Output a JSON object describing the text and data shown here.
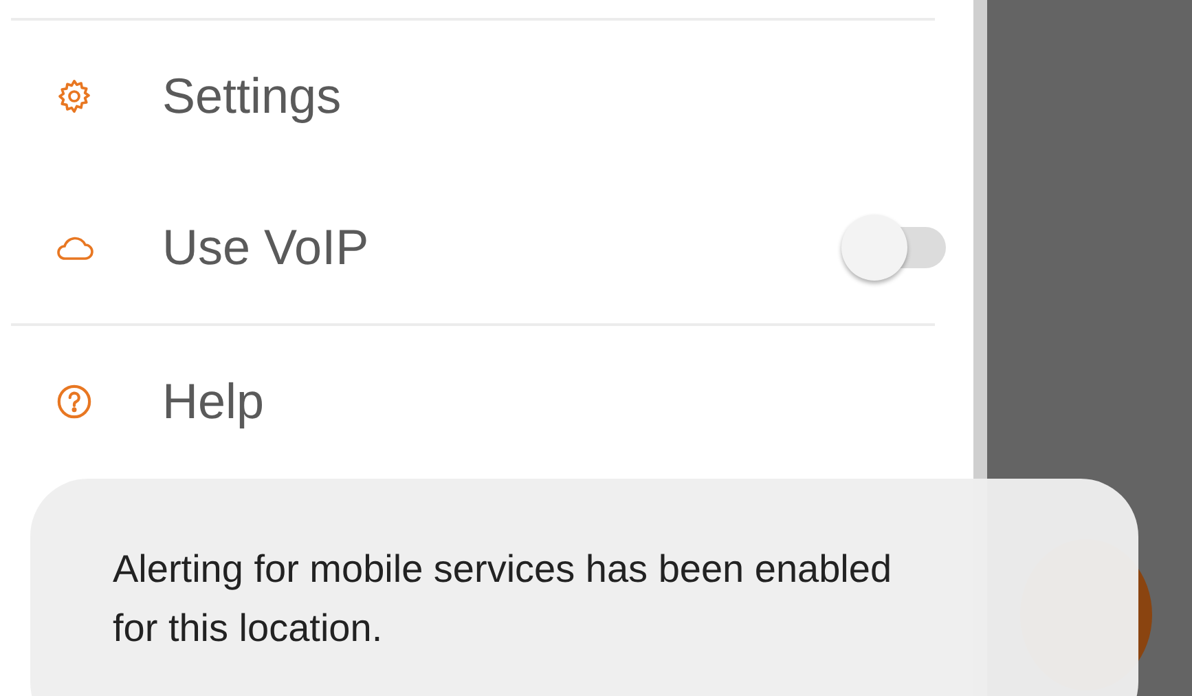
{
  "drawer": {
    "sections": [
      {
        "items": [
          {
            "label": "Settings",
            "kind": "link"
          },
          {
            "label": "Use VoIP",
            "kind": "toggle",
            "on": false
          }
        ]
      },
      {
        "items": [
          {
            "label": "Help",
            "kind": "link"
          }
        ]
      }
    ]
  },
  "toast": {
    "message": "Alerting for mobile services has been enabled for this location."
  }
}
